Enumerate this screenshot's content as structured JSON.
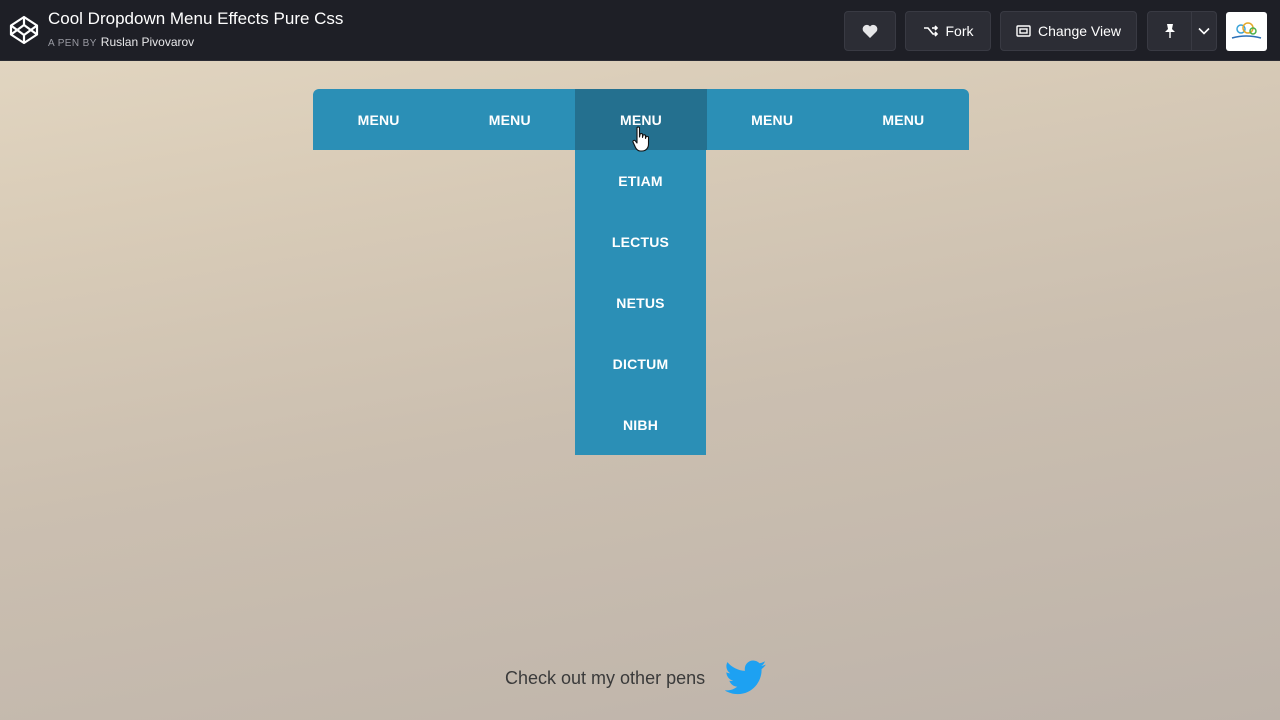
{
  "header": {
    "title": "Cool Dropdown Menu Effects Pure Css",
    "byline_prefix": "A PEN BY",
    "author": "Ruslan Pivovarov",
    "buttons": {
      "fork": "Fork",
      "change_view": "Change View"
    },
    "icons": [
      "codepen-logo-icon",
      "heart-icon",
      "fork-icon",
      "change-view-icon",
      "pin-icon",
      "chevron-down-icon"
    ]
  },
  "menu": {
    "items": [
      "MENU",
      "MENU",
      "MENU",
      "MENU",
      "MENU"
    ],
    "active_index": 2,
    "dropdown": [
      "ETIAM",
      "LECTUS",
      "NETUS",
      "DICTUM",
      "NIBH"
    ]
  },
  "footer": {
    "text": "Check out my other pens",
    "icon": "twitter-icon"
  },
  "colors": {
    "topbar": "#1e1f26",
    "menu": "#2b8fb6",
    "menu_active": "#24708f",
    "twitter": "#1da1f2"
  }
}
